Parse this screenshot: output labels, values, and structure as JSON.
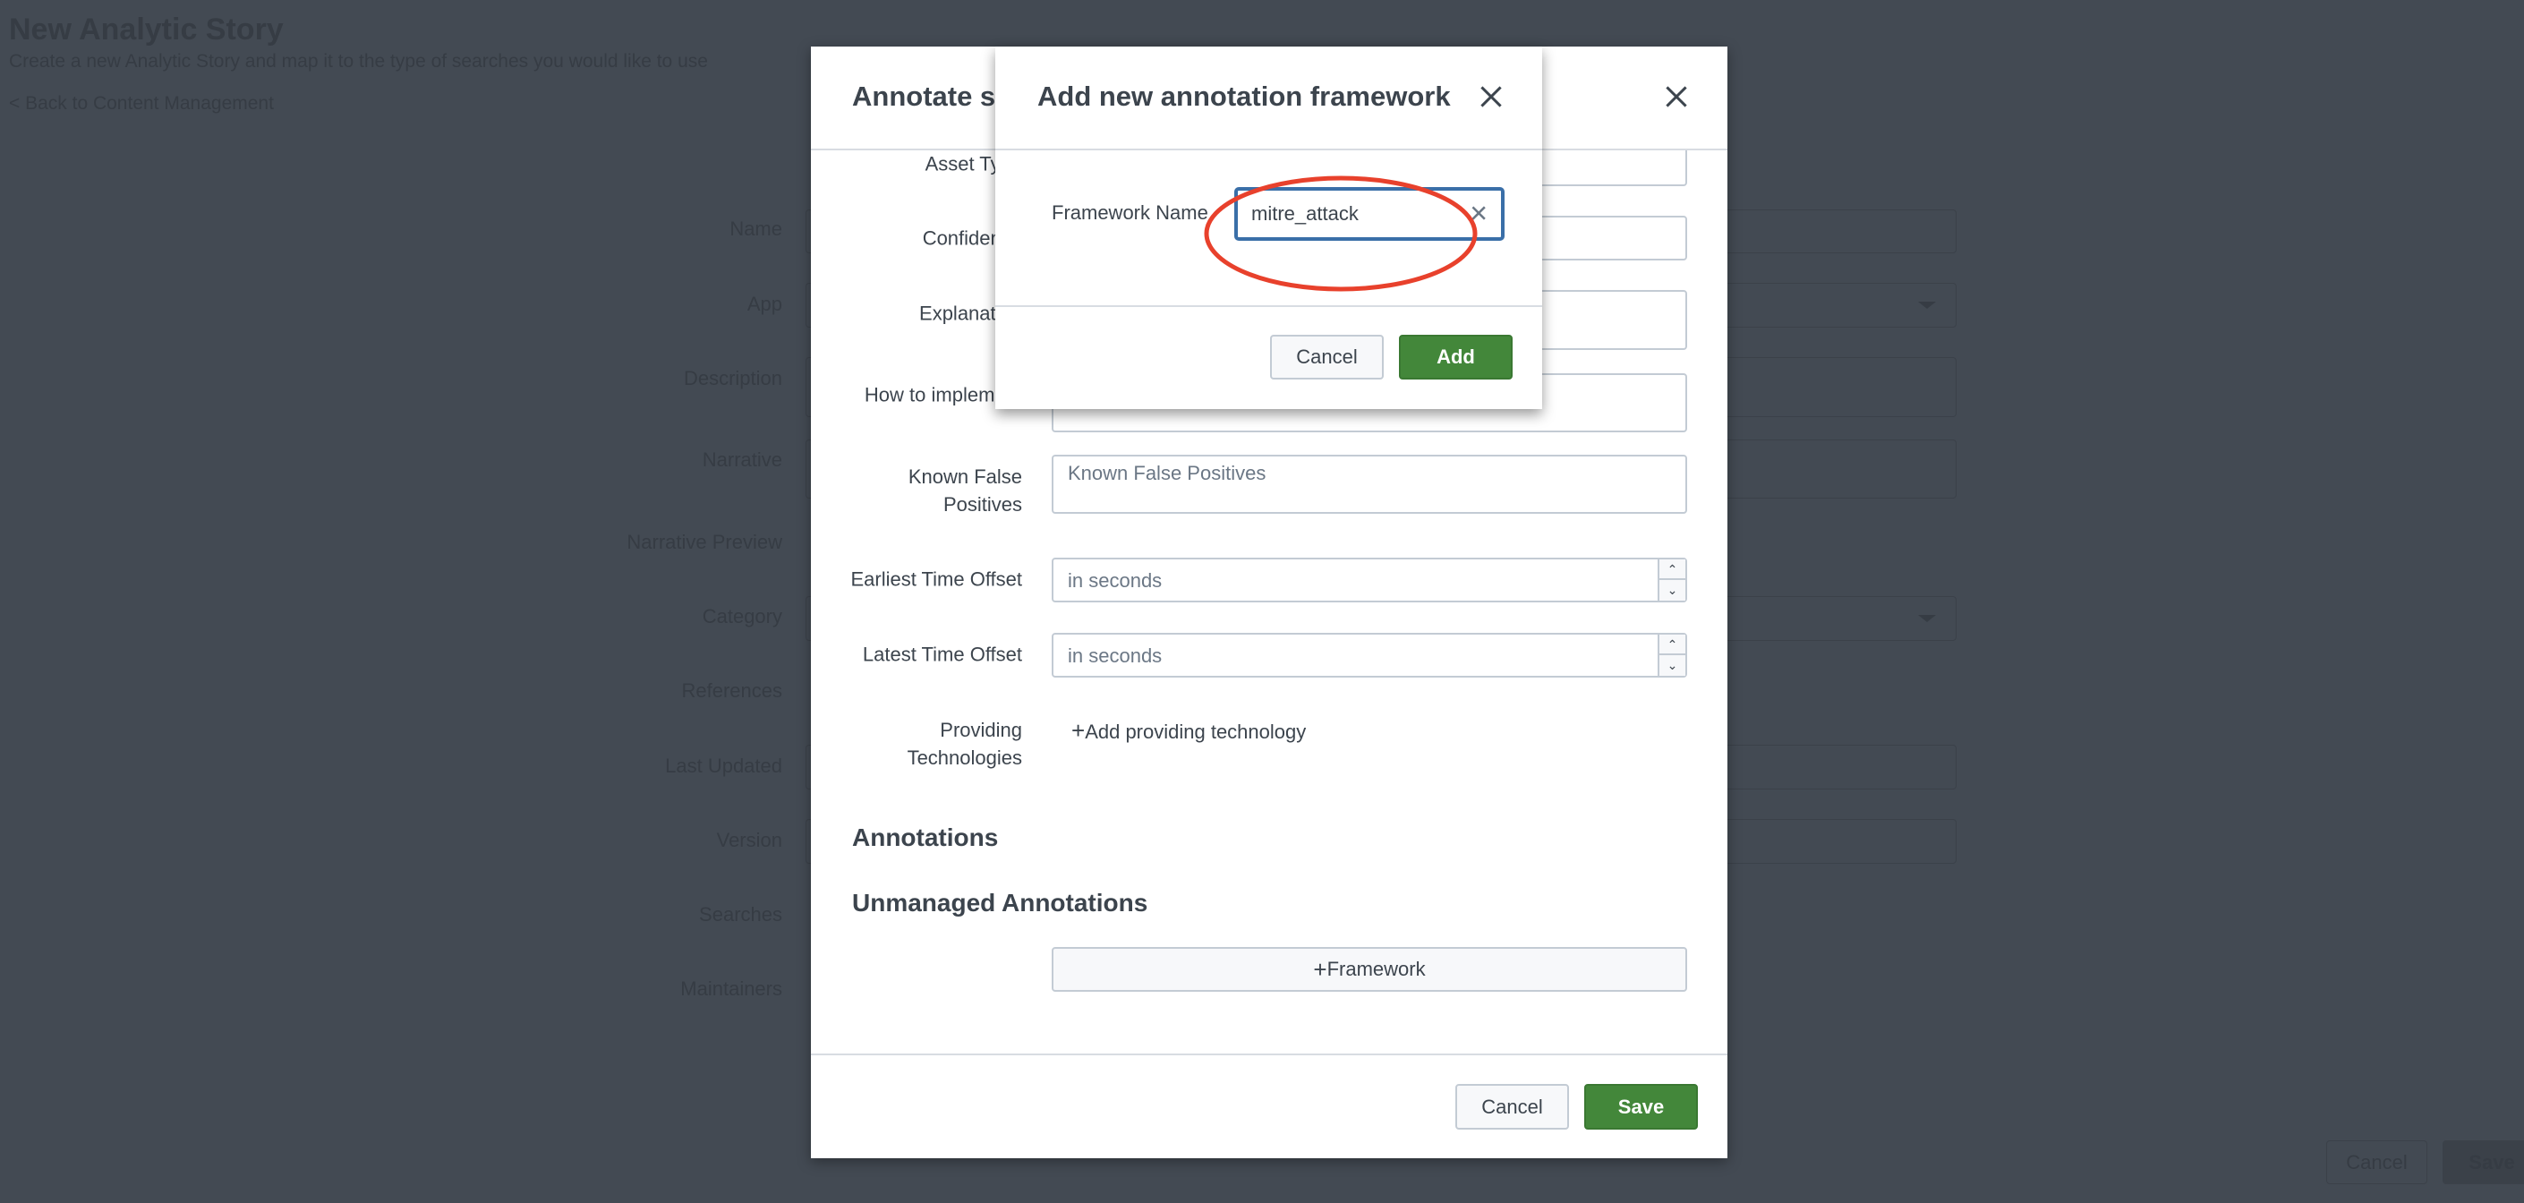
{
  "background": {
    "title": "New Analytic Story",
    "subtitle": "Create a new Analytic Story and map it to the type of searches you would like to use",
    "back_link": "< Back to Content Management",
    "labels": [
      "Name",
      "App",
      "Description",
      "Narrative",
      "Narrative Preview",
      "Category",
      "References",
      "Last Updated",
      "Version",
      "Searches",
      "Maintainers"
    ],
    "cancel_label": "Cancel",
    "save_label": "Save"
  },
  "annotate_modal": {
    "title": "Annotate search",
    "fields": {
      "asset_type": "Asset Type",
      "confidence": "Confidence",
      "explanation": "Explanation",
      "how_to_implement": "How to implement",
      "known_false_positives": "Known False Positives",
      "known_false_positives_placeholder": "Known False Positives",
      "earliest_time_offset": "Earliest Time Offset",
      "earliest_placeholder": "in seconds",
      "latest_time_offset": "Latest Time Offset",
      "latest_placeholder": "in seconds",
      "providing_technologies": "Providing Technologies",
      "add_providing_technology": "Add providing technology"
    },
    "annotations_heading": "Annotations",
    "unmanaged_heading": "Unmanaged Annotations",
    "framework_button": "Framework",
    "cancel_label": "Cancel",
    "save_label": "Save"
  },
  "framework_modal": {
    "title": "Add new annotation framework",
    "field_label": "Framework Name",
    "field_value": "mitre_attack",
    "cancel_label": "Cancel",
    "add_label": "Add"
  },
  "colors": {
    "primary_green": "#43873a",
    "focus_blue": "#3a6fa8",
    "highlight_red": "#e8412c",
    "overlay": "#434a53"
  }
}
